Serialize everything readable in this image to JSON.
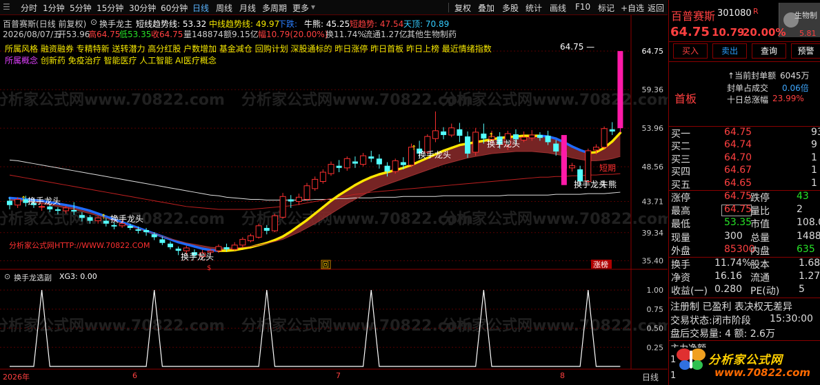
{
  "toolbar": {
    "tabs": [
      "分时",
      "1分钟",
      "5分钟",
      "15分钟",
      "30分钟",
      "60分钟",
      "日线",
      "周线",
      "月线",
      "多周期",
      "更多"
    ],
    "active_tab": "日线",
    "buttons": [
      "复权",
      "叠加",
      "多股",
      "统计",
      "画线",
      "F10",
      "标记",
      "+自选",
      "返回"
    ]
  },
  "header": {
    "stock_name": "百普赛斯",
    "mode": "(日线 前复权)",
    "indicator_name": "换手龙主",
    "short_trend": "短线趋势线: 53.32",
    "mid_trend": "中线趋势线: 49.97",
    "down_label": "下跌:",
    "bull": "牛熊: 45.25",
    "short_trend2": "短趋势: 47.54",
    "top": "天顶: 70.89"
  },
  "info_line": {
    "date": "2026/08/07/五",
    "open": "开53.96",
    "high": "高64.75",
    "low": "低53.35",
    "close": "收64.75",
    "vol": "量148874",
    "amount": "额9.15亿",
    "change": "幅10.79(20.00%)",
    "turnover": "换11.74%",
    "float": "流通1.27亿",
    "industry": "其他生物制药"
  },
  "concepts": {
    "style": "所属风格 融资融券 专精特新 送转潜力 高分红股 户数增加 基金减仓 回购计划 深股通标的 昨日涨停 昨日首板 昨日上榜 最近情绪指数",
    "concept": "所属概念 创新药 免疫治疗 智能医疗 人工智能 AI医疗概念"
  },
  "chart_labels": {
    "price_max": "64.75",
    "short_line_tag": "短期",
    "bull_tag": "牛熊",
    "watermark_url": "分析家公式网HTTP://WWW.70822.COM",
    "hs_labels": [
      "换手龙头",
      "换手龙头",
      "换手龙头",
      "换手龙头",
      "换手龙头",
      "换手龙头"
    ],
    "limit_tag": "涨榜",
    "event_marks": [
      "回",
      "$"
    ],
    "watermark_text": "分析家公式网www.70822.com"
  },
  "sub_panel": {
    "title": "换手龙选副",
    "value": "XG3: 0.00",
    "y_ticks": [
      "1.00",
      "0.75",
      "0.50",
      "0.25"
    ]
  },
  "x_axis": {
    "labels": [
      "2026年",
      "6",
      "7",
      "8"
    ],
    "period": "日线"
  },
  "chart_data": [
    {
      "type": "candlestick",
      "ylim": [
        34.5,
        66.5
      ],
      "y_ticks": [
        "64.75",
        "59.36",
        "53.96",
        "48.56",
        "43.71",
        "39.34",
        "35.40"
      ],
      "candles": [
        [
          43.8,
          43.2,
          44.3,
          42.6
        ],
        [
          43.2,
          44.0,
          44.3,
          42.8
        ],
        [
          44.0,
          43.5,
          44.5,
          43.0
        ],
        [
          43.5,
          43.2,
          44.0,
          42.8
        ],
        [
          43.0,
          43.0,
          43.4,
          42.4
        ],
        [
          43.0,
          42.6,
          43.3,
          42.2
        ],
        [
          42.6,
          42.4,
          42.9,
          41.9
        ],
        [
          42.4,
          42.8,
          43.1,
          42.0
        ],
        [
          42.5,
          42.3,
          43.6,
          41.8
        ],
        [
          41.8,
          41.4,
          42.2,
          40.9
        ],
        [
          41.5,
          41.0,
          41.8,
          40.6
        ],
        [
          41.0,
          41.4,
          41.7,
          40.6
        ],
        [
          41.0,
          40.6,
          41.4,
          40.2
        ],
        [
          40.4,
          40.2,
          40.8,
          39.8
        ],
        [
          40.3,
          40.6,
          41.1,
          40.0
        ],
        [
          40.3,
          40.0,
          40.6,
          39.7
        ],
        [
          39.8,
          39.6,
          40.2,
          39.2
        ],
        [
          39.7,
          39.4,
          40.0,
          38.9
        ],
        [
          39.1,
          38.7,
          39.4,
          38.3
        ],
        [
          38.4,
          37.9,
          38.8,
          37.6
        ],
        [
          37.8,
          37.3,
          38.1,
          37.0
        ],
        [
          37.1,
          36.8,
          37.4,
          36.2
        ],
        [
          36.8,
          37.2,
          37.5,
          36.3
        ],
        [
          36.6,
          36.2,
          37.0,
          35.8
        ],
        [
          36.0,
          36.5,
          36.9,
          35.7
        ],
        [
          36.6,
          36.8,
          37.1,
          36.2
        ],
        [
          36.8,
          37.4,
          37.7,
          36.5
        ],
        [
          37.3,
          37.0,
          37.8,
          36.7
        ],
        [
          37.0,
          37.6,
          38.0,
          36.8
        ],
        [
          37.6,
          38.4,
          38.7,
          37.3
        ],
        [
          38.2,
          38.9,
          39.2,
          38.0
        ],
        [
          38.7,
          40.3,
          40.6,
          38.5
        ],
        [
          40.0,
          39.6,
          40.4,
          39.1
        ],
        [
          39.6,
          41.7,
          42.0,
          39.4
        ],
        [
          41.5,
          44.4,
          44.9,
          41.3
        ],
        [
          44.0,
          43.7,
          44.6,
          42.8
        ],
        [
          43.7,
          44.3,
          44.8,
          43.2
        ],
        [
          44.0,
          45.9,
          46.3,
          43.8
        ],
        [
          45.5,
          46.8,
          47.2,
          45.2
        ],
        [
          46.5,
          47.8,
          48.2,
          46.2
        ],
        [
          47.6,
          48.9,
          49.3,
          47.3
        ],
        [
          48.7,
          48.4,
          49.5,
          47.8
        ],
        [
          48.4,
          49.7,
          50.0,
          48.0
        ],
        [
          49.3,
          49.0,
          50.0,
          48.4
        ],
        [
          48.9,
          50.1,
          50.5,
          48.6
        ],
        [
          50.0,
          49.7,
          50.8,
          49.2
        ],
        [
          49.7,
          48.9,
          50.3,
          48.3
        ],
        [
          48.7,
          47.9,
          49.2,
          47.2
        ],
        [
          47.9,
          49.4,
          49.7,
          47.6
        ],
        [
          49.2,
          48.8,
          49.9,
          48.2
        ],
        [
          48.8,
          51.3,
          51.8,
          48.5
        ],
        [
          51.1,
          50.4,
          52.2,
          49.9
        ],
        [
          50.6,
          52.8,
          53.1,
          50.3
        ],
        [
          52.5,
          53.6,
          56.3,
          52.0
        ],
        [
          53.5,
          53.0,
          54.1,
          52.4
        ],
        [
          53.0,
          54.0,
          54.6,
          52.7
        ],
        [
          53.8,
          52.9,
          54.7,
          52.0
        ],
        [
          52.8,
          50.4,
          53.5,
          49.8
        ],
        [
          50.6,
          53.4,
          54.0,
          50.1
        ],
        [
          53.2,
          52.5,
          54.6,
          51.8
        ],
        [
          52.4,
          52.8,
          53.6,
          51.9
        ],
        [
          52.8,
          51.7,
          53.4,
          51.1
        ],
        [
          51.6,
          53.2,
          53.6,
          50.9
        ],
        [
          53.1,
          52.4,
          53.8,
          51.8
        ],
        [
          52.3,
          52.7,
          53.5,
          52.0
        ],
        [
          52.6,
          53.0,
          53.7,
          52.2
        ],
        [
          53.0,
          52.6,
          53.4,
          52.2
        ],
        [
          52.9,
          52.0,
          53.6,
          51.6
        ],
        [
          51.8,
          50.7,
          52.3,
          50.1
        ],
        [
          50.7,
          48.3,
          51.0,
          47.6
        ],
        [
          48.4,
          48.7,
          49.1,
          47.9
        ],
        [
          48.2,
          46.5,
          48.7,
          46.0
        ],
        [
          46.5,
          50.8,
          51.1,
          46.3
        ],
        [
          50.9,
          51.3,
          51.7,
          50.3
        ],
        [
          51.3,
          53.9,
          54.2,
          51.1
        ],
        [
          53.8,
          53.5,
          54.8,
          53.0
        ],
        [
          53.96,
          64.75,
          64.75,
          53.35
        ]
      ],
      "short_trend_line": [
        44.2,
        44.1,
        44.0,
        43.9,
        43.8,
        43.6,
        43.4,
        43.2,
        43.0,
        42.7,
        42.4,
        42.0,
        41.6,
        41.2,
        40.8,
        40.4,
        40.0,
        39.6,
        39.2,
        38.8,
        38.4,
        38.0,
        37.7,
        37.4,
        37.1,
        36.9,
        36.8,
        36.8,
        36.9,
        37.1,
        37.3,
        37.6,
        37.9,
        38.3,
        38.8,
        39.5,
        40.3,
        41.1,
        42.0,
        42.9,
        43.8,
        44.6,
        45.3,
        46.0,
        46.6,
        47.1,
        47.5,
        47.8,
        48.1,
        48.4,
        48.8,
        49.3,
        49.8,
        50.3,
        50.8,
        51.2,
        51.6,
        51.8,
        52.0,
        52.2,
        52.4,
        52.6,
        52.7,
        52.8,
        52.9,
        52.9,
        52.9,
        52.8,
        52.5,
        52.0,
        51.4,
        50.9,
        50.5,
        50.6,
        51.2,
        52.1,
        53.3
      ],
      "mid_trend_line": [
        43.9,
        43.8,
        43.7,
        43.6,
        43.4,
        43.2,
        43.0,
        42.8,
        42.6,
        42.3,
        42.0,
        41.7,
        41.4,
        41.0,
        40.6,
        40.2,
        39.9,
        39.5,
        39.2,
        38.8,
        38.5,
        38.2,
        37.9,
        37.7,
        37.5,
        37.3,
        37.2,
        37.2,
        37.2,
        37.3,
        37.4,
        37.6,
        37.8,
        38.1,
        38.4,
        38.9,
        39.4,
        40.0,
        40.6,
        41.3,
        42.0,
        42.7,
        43.4,
        44.0,
        44.6,
        45.2,
        45.7,
        46.1,
        46.5,
        46.9,
        47.3,
        47.7,
        48.1,
        48.5,
        48.9,
        49.2,
        49.5,
        49.8,
        50.0,
        50.2,
        50.4,
        50.5,
        50.6,
        50.7,
        50.7,
        50.7,
        50.6,
        50.5,
        50.3,
        50.1,
        49.8,
        49.6,
        49.4,
        49.4,
        49.5,
        49.7,
        50.0
      ],
      "white_line": [
        49.5,
        49.4,
        49.2,
        49.0,
        48.8,
        48.6,
        48.4,
        48.2,
        48.0,
        47.8,
        47.6,
        47.4,
        47.2,
        47.0,
        46.8,
        46.6,
        46.4,
        46.2,
        46.0,
        45.8,
        45.6,
        45.4,
        45.2,
        45.0,
        44.8,
        44.6,
        44.5,
        44.3,
        44.2,
        44.1,
        44.0,
        44.0,
        43.9,
        43.9,
        43.9,
        43.9,
        43.9,
        43.9,
        44.0,
        44.0,
        44.0,
        44.1,
        44.1,
        44.2,
        44.2,
        44.2,
        44.3,
        44.3,
        44.3,
        44.4,
        44.4,
        44.4,
        44.4,
        44.4,
        44.5,
        44.5,
        44.5,
        44.5,
        44.5,
        44.5,
        44.5,
        44.5,
        44.6,
        44.6,
        44.6,
        44.6,
        44.6,
        44.6,
        44.7,
        44.7,
        44.7,
        44.7,
        44.8,
        44.8,
        44.8,
        44.9,
        45.0
      ],
      "red_line": [
        47.4,
        47.2,
        47.0,
        46.8,
        46.6,
        46.4,
        46.2,
        46.0,
        45.8,
        45.6,
        45.4,
        45.2,
        45.0,
        44.8,
        44.6,
        44.4,
        44.2,
        44.0,
        43.8,
        43.6,
        43.4,
        43.2,
        43.0,
        42.9,
        42.8,
        42.7,
        42.6,
        42.6,
        42.6,
        42.6,
        42.6,
        42.7,
        42.8,
        42.9,
        43.0,
        43.1,
        43.3,
        43.5,
        43.7,
        43.9,
        44.1,
        44.3,
        44.5,
        44.7,
        44.8,
        45.0,
        45.1,
        45.2,
        45.3,
        45.4,
        45.5,
        45.6,
        45.7,
        45.8,
        45.9,
        46.0,
        46.1,
        46.2,
        46.3,
        46.4,
        46.5,
        46.6,
        46.7,
        46.8,
        46.9,
        47.0,
        47.1,
        47.1,
        47.2,
        47.2,
        47.3,
        47.3,
        47.4,
        47.4,
        47.5,
        47.5,
        47.6
      ]
    },
    {
      "type": "line",
      "ylim": [
        0,
        1.1
      ],
      "spikes_at": [
        4,
        18,
        32,
        45,
        59,
        72
      ],
      "values_note": ""
    }
  ],
  "right_panel": {
    "name": "百普赛斯",
    "code": "301080",
    "r_badge": "R",
    "price": "64.75",
    "change": "10.79",
    "pct": "20.00%",
    "thumb_label": "生物制",
    "thumb_pct": "5.81",
    "buttons": [
      "买入",
      "卖出",
      "查询",
      "预警"
    ],
    "board_label": "首板",
    "seal_info": [
      {
        "label": "当前封单额",
        "value": "6045万"
      },
      {
        "label": "封单占成交",
        "value": "0.06倍"
      },
      {
        "label": "十日总涨幅",
        "value": "23.99%"
      }
    ],
    "bids": [
      {
        "label": "买一",
        "price": "64.75",
        "vol": "93"
      },
      {
        "label": "买二",
        "price": "64.74",
        "vol": "9"
      },
      {
        "label": "买三",
        "price": "64.70",
        "vol": "1"
      },
      {
        "label": "买四",
        "price": "64.67",
        "vol": "1"
      },
      {
        "label": "买五",
        "price": "64.65",
        "vol": "1"
      }
    ],
    "stats": [
      {
        "l1": "涨停",
        "v1": "64.75",
        "l2": "跌停",
        "v2": "43"
      },
      {
        "l1": "最高",
        "v1": "64.75",
        "l2": "量比",
        "v2": "2"
      },
      {
        "l1": "最低",
        "v1": "53.35",
        "l2": "市值",
        "v2": "108.0"
      },
      {
        "l1": "现量",
        "v1": "300",
        "l2": "总量",
        "v2": "1488"
      },
      {
        "l1": "外盘",
        "v1": "85300",
        "l2": "内盘",
        "v2": "635"
      }
    ],
    "fin": [
      {
        "l1": "换手",
        "v1": "11.74%",
        "l2": "股本",
        "v2": "1.68"
      },
      {
        "l1": "净资",
        "v1": "16.16",
        "l2": "流通",
        "v2": "1.27"
      },
      {
        "l1": "收益(一)",
        "v1": "0.280",
        "l2": "PE(动)",
        "v2": "5"
      }
    ],
    "registration": "注册制 已盈利 表决权无差异",
    "trade_status_label": "交易状态:",
    "trade_status": "闭市阶段",
    "trade_time": "15:30:00",
    "after_hours": "盘后交易量: 4 额: 2.6万",
    "partial_row": "主力净额",
    "logo_text": "分析家公式网",
    "logo_url": "www.70822.com"
  }
}
